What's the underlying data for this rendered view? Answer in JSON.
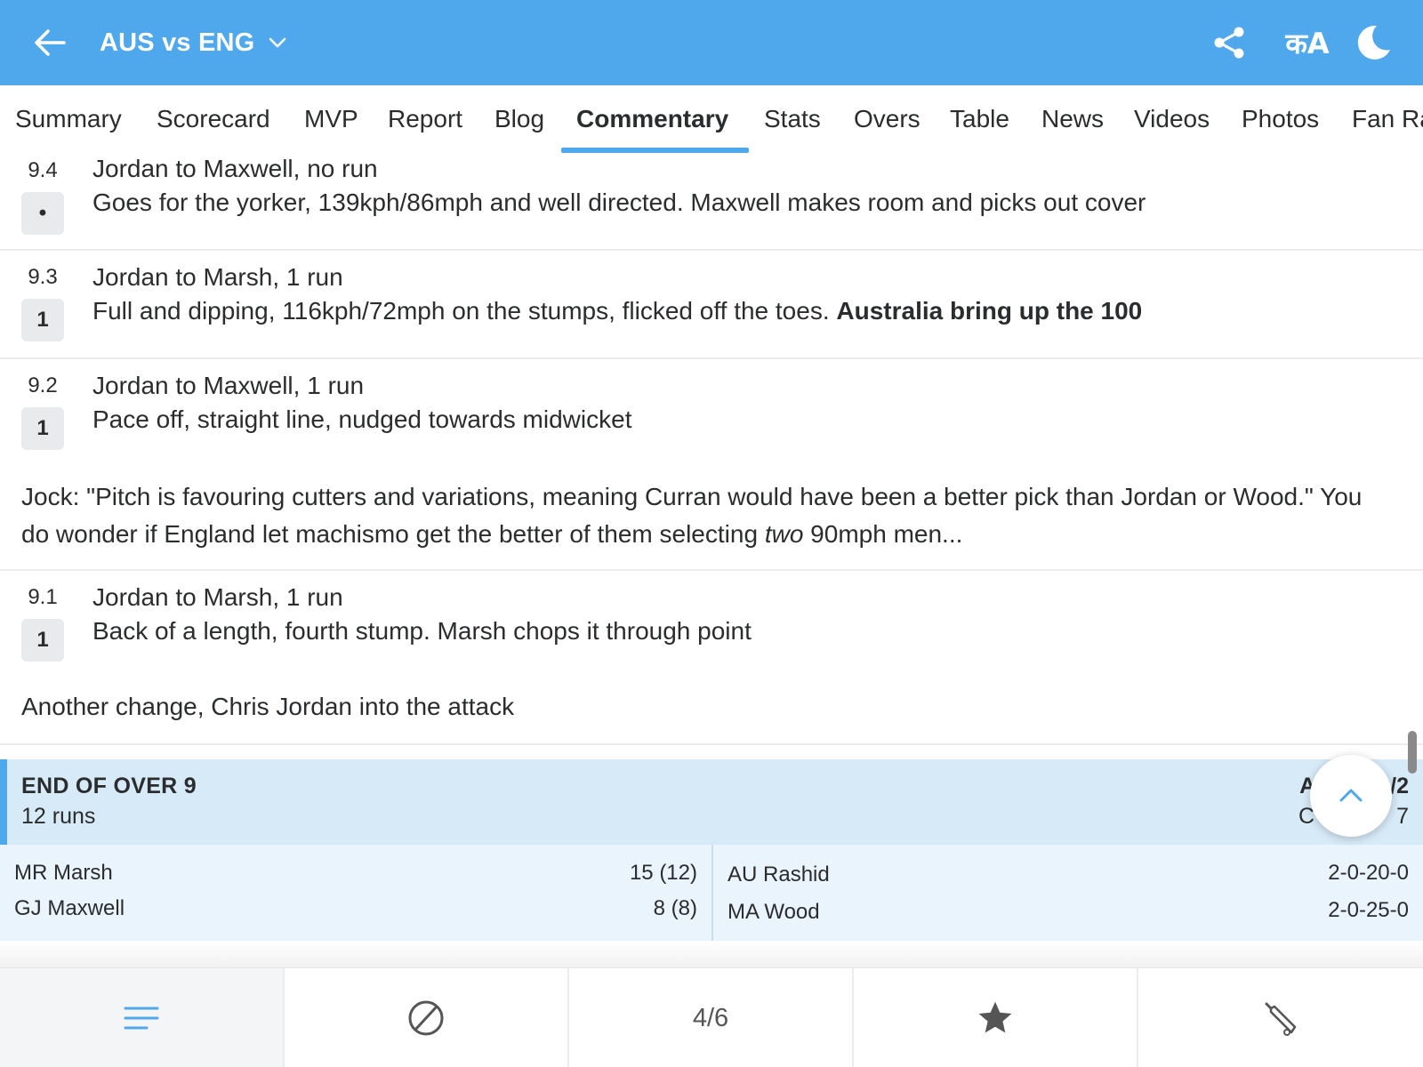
{
  "header": {
    "title": "AUS vs ENG",
    "lang_label": "कA"
  },
  "tabs": [
    {
      "label": "Summary"
    },
    {
      "label": "Scorecard"
    },
    {
      "label": "MVP"
    },
    {
      "label": "Report"
    },
    {
      "label": "Blog"
    },
    {
      "label": "Commentary"
    },
    {
      "label": "Stats"
    },
    {
      "label": "Overs"
    },
    {
      "label": "Table"
    },
    {
      "label": "News"
    },
    {
      "label": "Videos"
    },
    {
      "label": "Photos"
    },
    {
      "label": "Fan Ra"
    }
  ],
  "active_tab": "Commentary",
  "commentary": [
    {
      "over": "9.4",
      "result": "•",
      "title": "Jordan to Maxwell, no run",
      "text": "Goes for the yorker, 139kph/86mph and well directed. Maxwell makes room and picks out cover"
    },
    {
      "over": "9.3",
      "result": "1",
      "title": "Jordan to Marsh, 1 run",
      "text": "Full and dipping, 116kph/72mph on the stumps, flicked off the toes.",
      "text_bold": "Australia bring up the 100"
    },
    {
      "over": "9.2",
      "result": "1",
      "title": "Jordan to Maxwell, 1 run",
      "text": "Pace off, straight line, nudged towards midwicket",
      "note_part1": "Jock: \"Pitch is favouring cutters and variations, meaning Curran would have been a better pick than Jordan or Wood.\" You do wonder if England let machismo get the better of them selecting",
      "note_italic": "two",
      "note_part2": "90mph men..."
    },
    {
      "over": "9.1",
      "result": "1",
      "title": "Jordan to Marsh, 1 run",
      "text": "Back of a length, fourth stump. Marsh chops it through point",
      "note": "Another change, Chris Jordan into the attack"
    }
  ],
  "end_of_over": {
    "title": "END OF OVER 9",
    "runs": "12 runs",
    "score_partial": "A",
    "score_partial_end": "/2",
    "rate_partial": "C",
    "rate_partial_end": "7",
    "batters": [
      {
        "name": "MR Marsh",
        "score": "15 (12)"
      },
      {
        "name": "GJ Maxwell",
        "score": "8 (8)"
      }
    ],
    "bowlers": [
      {
        "name": "AU Rashid",
        "figures": "2-0-20-0"
      },
      {
        "name": "MA Wood",
        "figures": "2-0-25-0"
      }
    ]
  },
  "bottom_nav": {
    "pager": "4/6"
  },
  "colors": {
    "primary": "#4fa7ec",
    "eoo_bg": "#d7eaf8",
    "eoo_stats_bg": "#e9f4fc"
  }
}
